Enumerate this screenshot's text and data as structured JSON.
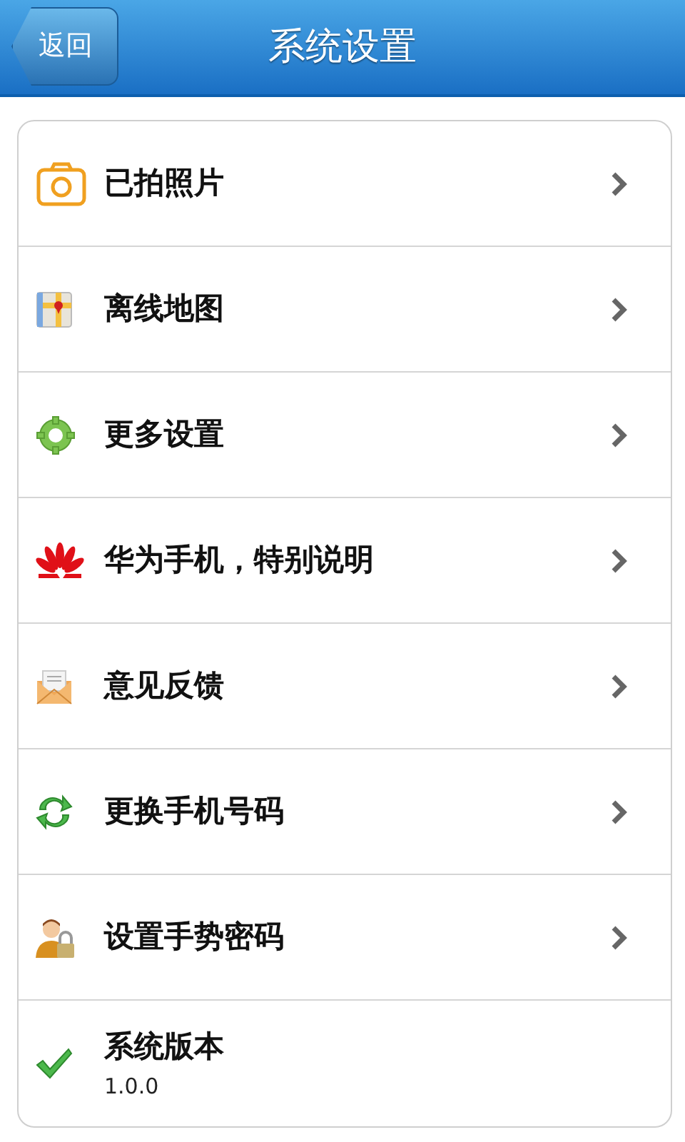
{
  "header": {
    "back_button": "返回",
    "title": "系统设置"
  },
  "items": [
    {
      "kind": "link",
      "label": "已拍照片"
    },
    {
      "kind": "link",
      "label": "离线地图"
    },
    {
      "kind": "link",
      "label": "更多设置"
    },
    {
      "kind": "link",
      "label": "华为手机，特别说明"
    },
    {
      "kind": "link",
      "label": "意见反馈"
    },
    {
      "kind": "link",
      "label": "更换手机号码"
    },
    {
      "kind": "link",
      "label": "设置手势密码"
    },
    {
      "kind": "info",
      "label": "系统版本",
      "value": "1.0.0"
    }
  ]
}
